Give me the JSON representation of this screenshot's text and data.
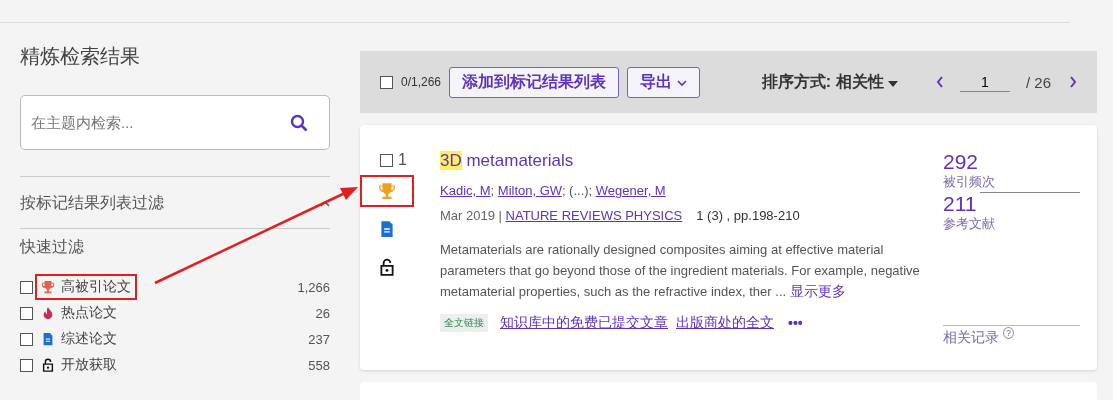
{
  "sidebar": {
    "title": "精炼检索结果",
    "search": {
      "placeholder": "在主题内检索..."
    },
    "marked_filter": {
      "label": "按标记结果列表过滤",
      "expanded": true
    },
    "quick_filter": {
      "title": "快速过滤",
      "items": [
        {
          "kind": "trophy",
          "label": "高被引论文",
          "count": "1,266",
          "checked": false,
          "highlighted": true
        },
        {
          "kind": "flame",
          "label": "热点论文",
          "count": "26",
          "checked": false,
          "highlighted": false
        },
        {
          "kind": "document",
          "label": "综述论文",
          "count": "237",
          "checked": false,
          "highlighted": false
        },
        {
          "kind": "lock",
          "label": "开放获取",
          "count": "558",
          "checked": false,
          "highlighted": false
        }
      ]
    }
  },
  "toolbar": {
    "select_all": {
      "checked": false,
      "label": "0/1,266"
    },
    "add_button": "添加到标记结果列表",
    "export_button": "导出",
    "sort": "排序方式: 相关性",
    "page": "1",
    "total_pages": "/ 26"
  },
  "results": [
    {
      "checked": false,
      "number": "1",
      "title_highlight": "3D",
      "title_rest": " metamaterials",
      "badges": [
        {
          "kind": "trophy",
          "highlighted": true
        },
        {
          "kind": "document",
          "highlighted": false
        },
        {
          "kind": "lock",
          "highlighted": false
        }
      ],
      "authors": [
        {
          "name": "Kadic, M",
          "kind": "link"
        },
        {
          "name": "; ",
          "kind": "text"
        },
        {
          "name": "Milton, GW",
          "kind": "link"
        },
        {
          "name": "; (...); ",
          "kind": "text"
        },
        {
          "name": "Wegener, M",
          "kind": "link"
        }
      ],
      "date": "Mar 2019 | ",
      "journal": "NATURE REVIEWS PHYSICS",
      "volume": "1 (3) , pp.198-210",
      "abstract": "Metamaterials are rationally designed composites aiming at effective material parameters that go beyond those of the ingredient materials. For example, negative metamaterial properties, such as the refractive index, ther ...",
      "show_more": "显示更多",
      "fulltext_badge": "全文链接",
      "links": [
        "知识库中的免费已提交文章",
        "出版商处的全文"
      ],
      "more": "•••",
      "citations": "292",
      "citations_label": "被引频次",
      "references": "211",
      "references_label": "参考文献",
      "related": "相关记录",
      "help": "?"
    }
  ]
}
